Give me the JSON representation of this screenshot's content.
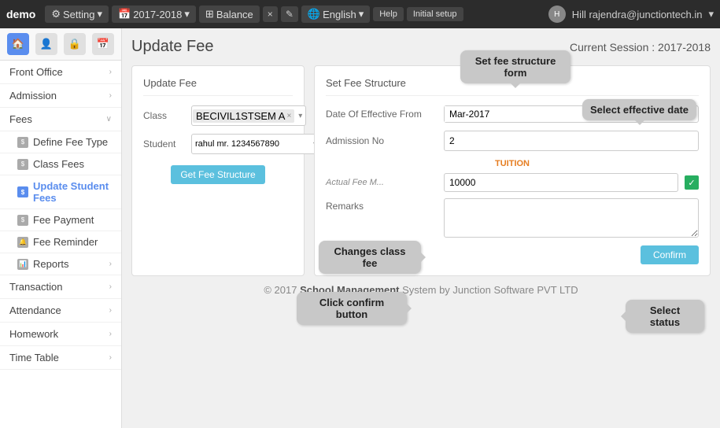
{
  "app": {
    "brand": "demo",
    "session_label": "2017-2018",
    "nav_buttons": [
      "Setting",
      "2017-2018",
      "Balance",
      "×",
      "✎",
      "English",
      "Help",
      "Initial setup"
    ],
    "user_name": "Hill rajendra@junctiontech.in"
  },
  "sidebar": {
    "icons": [
      "🏠",
      "👤",
      "🔒",
      "📅"
    ],
    "items": [
      {
        "label": "Front Office",
        "has_chevron": true
      },
      {
        "label": "Admission",
        "has_chevron": true
      },
      {
        "label": "Fees",
        "has_chevron": false,
        "expanded": true
      }
    ],
    "sub_items": [
      {
        "label": "Define Fee Type",
        "active": false
      },
      {
        "label": "Class Fees",
        "active": false
      },
      {
        "label": "Update Student Fees",
        "active": true
      },
      {
        "label": "Fee Payment",
        "active": false
      },
      {
        "label": "Fee Reminder",
        "active": false
      },
      {
        "label": "Reports",
        "active": false,
        "has_chevron": true
      }
    ],
    "more_items": [
      {
        "label": "Transaction",
        "has_chevron": true
      },
      {
        "label": "Attendance",
        "has_chevron": true
      },
      {
        "label": "Homework",
        "has_chevron": true
      },
      {
        "label": "Time Table",
        "has_chevron": true
      }
    ]
  },
  "page": {
    "title": "Update Fee",
    "current_session": "Current Session : 2017-2018"
  },
  "update_fee_card": {
    "title": "Update Fee",
    "class_label": "Class",
    "class_value": "BECIVIL1STSEM A",
    "student_label": "Student",
    "student_value": "rahul mr. 1234567890",
    "get_fee_btn": "Get Fee Structure"
  },
  "set_fee_card": {
    "title": "Set Fee Structure",
    "date_label": "Date Of Effective From",
    "date_value": "Mar-2017",
    "admission_label": "Admission No",
    "admission_value": "2",
    "tuition_header": "TUITION",
    "tuition_amount": "10000",
    "tuition_actual_label": "Actual Fee M...",
    "remarks_label": "Remarks",
    "remarks_value": "",
    "confirm_btn": "Confirm"
  },
  "callouts": {
    "set_fee_label": "Set fee structure form",
    "effective_date_label": "Select effective date",
    "changes_class_fee_label": "Changes class fee",
    "confirm_btn_label": "Click confirm button",
    "select_status_label": "Select status"
  },
  "footer": {
    "text": "© 2017 School Management System by Junction Software PVT LTD"
  }
}
